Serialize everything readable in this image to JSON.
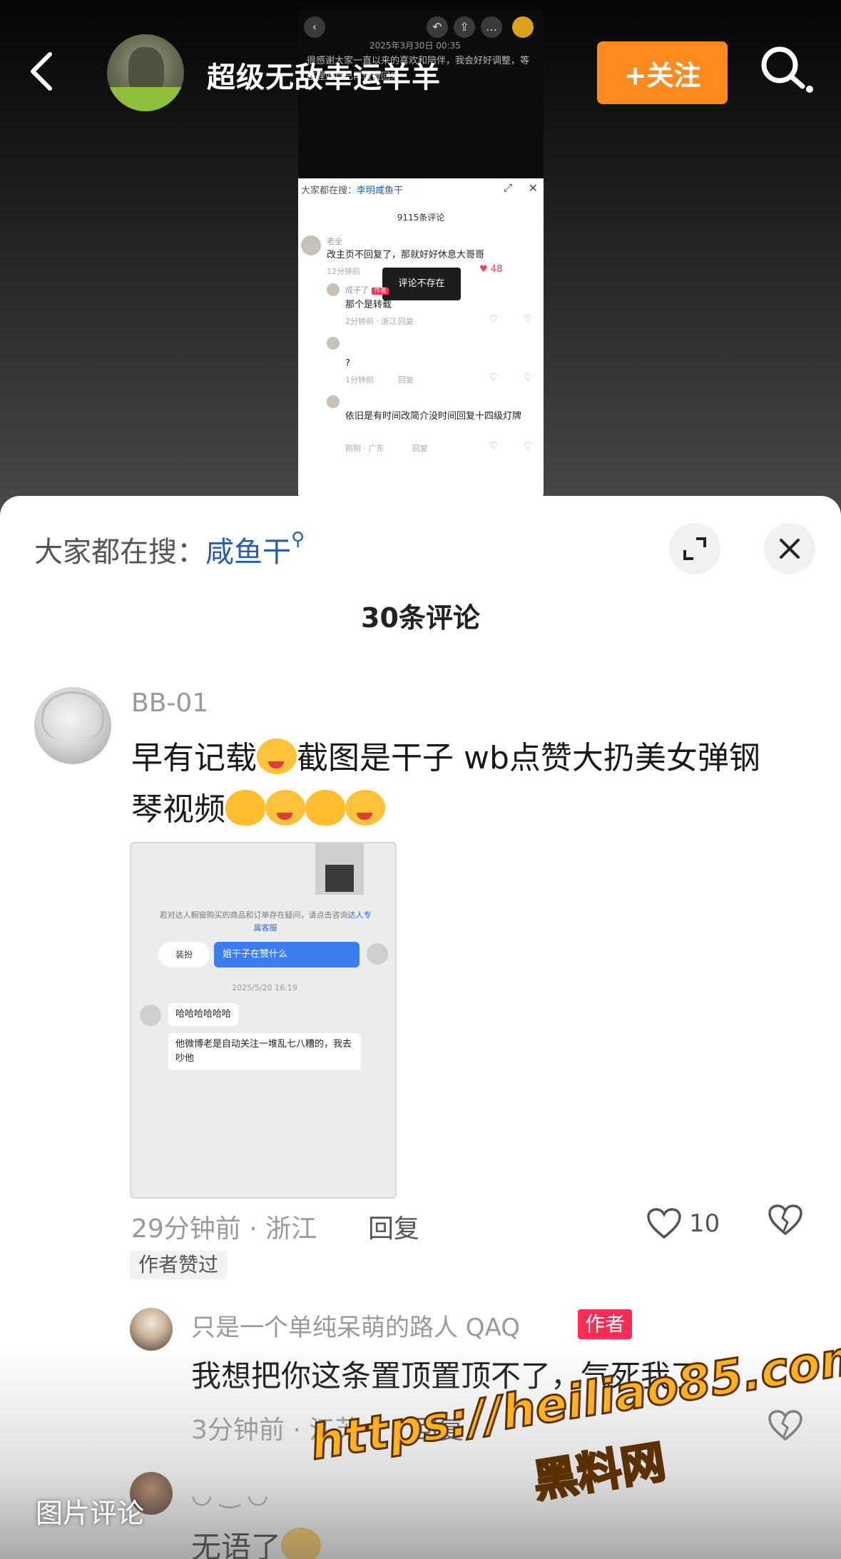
{
  "header": {
    "username": "超级无敌幸运羊羊",
    "follow_label": "+关注"
  },
  "inner_screenshot": {
    "date": "2025年3月30日 00:35",
    "body": "很感谢大家一直以来的喜欢和陪伴，我会好好调整，等整理好自己再慢慢回来",
    "search_prefix": "大家都在搜：",
    "search_keyword": "李明咸鱼干",
    "comment_count": "9115条评论",
    "toast": "评论不存在",
    "c1_name": "老全",
    "c1_text": "改主页不回复了，那就好好休息大哥哥",
    "c1_meta": "12分钟前",
    "c1_likes": "48",
    "c2_name": "成子了",
    "c2_tag": "作者",
    "c2_text": "那个是转载",
    "c2_meta": "2分钟前 · 浙江",
    "c2_reply": "回复",
    "c3_text": "?",
    "c3_meta": "1分钟前",
    "c3_reply": "回复",
    "c4_text": "依旧是有时间改简介没时间回复十四级灯牌",
    "c4_meta": "刚刚 · 广东",
    "c4_reply": "回复"
  },
  "sheet": {
    "search_prefix": "大家都在搜：",
    "search_keyword": "咸鱼干",
    "comment_count": "30条评论"
  },
  "comment": {
    "author": "BB-01",
    "text_line1_a": "早有记载",
    "text_line1_b": "截图是干子 wb点赞大扔美女弹钢",
    "text_line2": "琴视频",
    "meta": "29分钟前 · 浙江",
    "reply_label": "回复",
    "likes": "10",
    "author_liked": "作者赞过",
    "image": {
      "note": "若对达人橱窗购买的商品和订单存在疑问，请点击咨询",
      "note_link": "达人专属客服",
      "chip": "装扮",
      "blue_msg": "姐干子在赞什么",
      "time": "2025/5/20 16:19",
      "bubble1": "哈哈哈哈哈哈",
      "bubble2": "他微博老是自动关注一堆乱七八糟的，我去吵他"
    }
  },
  "reply": {
    "author": "只是一个单纯呆萌的路人 QAQ",
    "tag": "作者",
    "text": "我想把你这条置顶置顶不了，气死我了",
    "meta": "3分钟前 · 江苏",
    "reply_label": "回复"
  },
  "reply2": {
    "author": "◡ ‿ ◡",
    "text": "无语了"
  },
  "overlay": {
    "pic_comment": "图片评论",
    "watermark_url": "https://heiliao85.com",
    "watermark_name": "黑料网"
  },
  "colors": {
    "follow": "#ff8a1e",
    "keyword": "#2c5cab",
    "author_tag": "#ff2d55"
  }
}
